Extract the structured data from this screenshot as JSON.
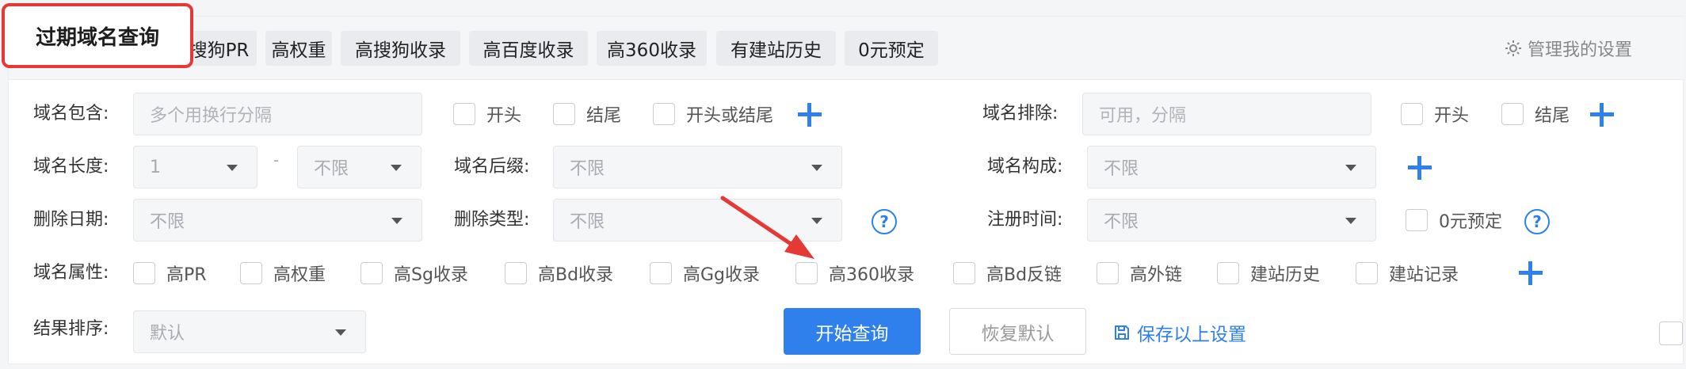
{
  "tabs": {
    "active": "过期域名查询",
    "items": [
      "高搜狗PR",
      "高权重",
      "高搜狗收录",
      "高百度收录",
      "高360收录",
      "有建站历史",
      "0元预定"
    ],
    "settings": "管理我的设置"
  },
  "filters": {
    "include": {
      "label": "域名包含:",
      "placeholder": "多个用换行分隔",
      "opts": [
        "开头",
        "结尾",
        "开头或结尾"
      ]
    },
    "exclude": {
      "label": "域名排除:",
      "placeholder": "可用，分隔",
      "opts": [
        "开头",
        "结尾"
      ]
    },
    "length": {
      "label": "域名长度:",
      "min": "1",
      "sep": "-",
      "max": "不限"
    },
    "suffix": {
      "label": "域名后缀:",
      "value": "不限"
    },
    "composition": {
      "label": "域名构成:",
      "value": "不限"
    },
    "delete_date": {
      "label": "删除日期:",
      "value": "不限"
    },
    "delete_type": {
      "label": "删除类型:",
      "value": "不限"
    },
    "reg_time": {
      "label": "注册时间:",
      "value": "不限",
      "zero_reserve": "0元预定"
    },
    "attributes": {
      "label": "域名属性:",
      "opts": [
        "高PR",
        "高权重",
        "高Sg收录",
        "高Bd收录",
        "高Gg收录",
        "高360收录",
        "高Bd反链",
        "高外链",
        "建站历史",
        "建站记录"
      ]
    },
    "sort": {
      "label": "结果排序:",
      "value": "默认"
    }
  },
  "actions": {
    "search": "开始查询",
    "reset": "恢复默认",
    "save": "保存以上设置"
  },
  "help_glyph": "?",
  "colors": {
    "accent": "#2f80ed",
    "highlight": "#e53935"
  }
}
